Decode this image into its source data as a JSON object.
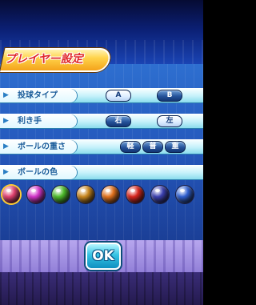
{
  "title": "プレイヤー設定",
  "throw_type": {
    "label": "投球タイプ",
    "options": [
      "A",
      "B"
    ]
  },
  "hand": {
    "label": "利き手",
    "options": [
      "右",
      "左"
    ]
  },
  "ball_weight": {
    "label": "ボールの重さ",
    "options": [
      "軽",
      "普",
      "重"
    ]
  },
  "ball_color": {
    "label": "ボールの色",
    "balls": [
      {
        "name": "rainbow-ball-icon",
        "color": "#e04070"
      },
      {
        "name": "magenta-ball-icon",
        "color": "#d233c9"
      },
      {
        "name": "green-ball-icon",
        "color": "#4dbb2a"
      },
      {
        "name": "gold-ball-icon",
        "color": "#c9871f"
      },
      {
        "name": "orange-ball-icon",
        "color": "#e2711c"
      },
      {
        "name": "red-ball-icon",
        "color": "#d8261d"
      },
      {
        "name": "galaxy-ball-icon",
        "color": "#3a3fb0"
      },
      {
        "name": "earth-ball-icon",
        "color": "#2f5fd0"
      }
    ]
  },
  "ok_label": "OK"
}
